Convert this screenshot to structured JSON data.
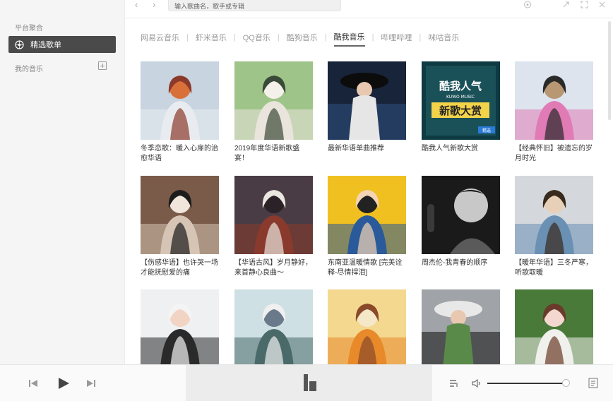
{
  "sidebar": {
    "section_platform": "平台聚合",
    "active_item": "精选歌单",
    "section_my_music": "我的音乐"
  },
  "topbar": {
    "back": "‹",
    "forward": "›",
    "search_placeholder": "输入歌曲名，歌手或专辑"
  },
  "tabs": [
    {
      "label": "网易云音乐",
      "active": false
    },
    {
      "label": "虾米音乐",
      "active": false
    },
    {
      "label": "QQ音乐",
      "active": false
    },
    {
      "label": "酷狗音乐",
      "active": false
    },
    {
      "label": "酷我音乐",
      "active": true
    },
    {
      "label": "哔哩哔哩",
      "active": false
    },
    {
      "label": "咪咕音乐",
      "active": false
    }
  ],
  "playlists": [
    {
      "title": "冬季恋歌：暖入心扉的治愈华语",
      "cover": "winter",
      "colors": [
        "#c8d4e0",
        "#e8ecf0",
        "#8b3a2a",
        "#d9703a"
      ]
    },
    {
      "title": "2019年度华语新歌盛宴！",
      "cover": "spring",
      "colors": [
        "#9fc48a",
        "#e9e4dc",
        "#3a4a38",
        "#f4f0ea"
      ]
    },
    {
      "title": "最新华语单曲推荐",
      "cover": "hat",
      "colors": [
        "#18243a",
        "#2d4c7a",
        "#0c0c0c",
        "#e6e6e6"
      ]
    },
    {
      "title": "酷我人气新歌大赏",
      "cover": "award",
      "colors": [
        "#0e3a42",
        "#1a5058",
        "#f2d34a",
        "#ffffff"
      ],
      "text_line1": "酷我人气",
      "text_line2": "新歌大赏",
      "text_small": "KUWO MUSIC",
      "badge": "精选"
    },
    {
      "title": "【经典怀旧】被遗忘的岁月时光",
      "cover": "retro",
      "colors": [
        "#dde4ee",
        "#e07bb6",
        "#2a2a2a",
        "#b79872"
      ]
    },
    {
      "title": "【伤感华语】也许哭一场才能抚慰爱的痛",
      "cover": "window",
      "colors": [
        "#7a5a48",
        "#d6c4b4",
        "#1c1c1c",
        "#f0e6dc"
      ]
    },
    {
      "title": "【华语古风】岁月静好，来首静心良曲～",
      "cover": "umbrella",
      "colors": [
        "#4a3c44",
        "#8a3a2c",
        "#eae6e0",
        "#2a2226"
      ]
    },
    {
      "title": "东南亚温暖情歌 [完美诠释-尽情捍泪]",
      "cover": "portrait",
      "colors": [
        "#f0c020",
        "#2a5a9a",
        "#f4d4b4",
        "#222222"
      ]
    },
    {
      "title": "周杰伦-我青春的顺序",
      "cover": "bw",
      "colors": [
        "#1a1a1a",
        "#5a5a5a",
        "#c8c8c8",
        "#3a3a3a"
      ]
    },
    {
      "title": "【暖年华语】三冬严寒，听歌取暖",
      "cover": "scarf",
      "colors": [
        "#d4d8dc",
        "#6a90b4",
        "#3a2a1e",
        "#e8d0b8"
      ]
    },
    {
      "title": "",
      "cover": "hanfu",
      "colors": [
        "#eef0f2",
        "#2a2a2a",
        "#f4f4f4",
        "#f2d4c4"
      ]
    },
    {
      "title": "",
      "cover": "anime",
      "colors": [
        "#cfe0e4",
        "#4a6a6a",
        "#f0f0f0",
        "#6a7a8a"
      ]
    },
    {
      "title": "",
      "cover": "guitar",
      "colors": [
        "#f4d890",
        "#e88a2a",
        "#8a4a2a",
        "#f4e8c8"
      ]
    },
    {
      "title": "",
      "cover": "blackhat",
      "colors": [
        "#a0a4a8",
        "#1a1a1a",
        "#e8e8e8",
        "#5a8a4a"
      ]
    },
    {
      "title": "",
      "cover": "flowers",
      "colors": [
        "#4a7a3a",
        "#f0f0ec",
        "#6a3a2a",
        "#f4d8d0"
      ]
    }
  ],
  "player": {
    "prev": "prev-icon",
    "play": "play-icon",
    "next": "next-icon",
    "volume_level": 0.97
  }
}
